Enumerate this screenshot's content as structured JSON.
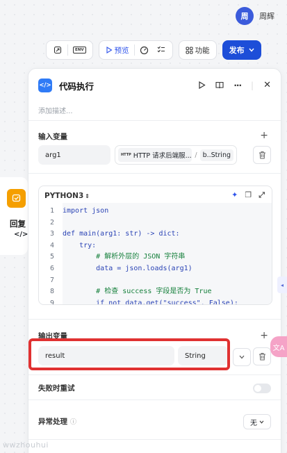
{
  "user": {
    "avatar_text": "周",
    "name": "周辉"
  },
  "toolbar": {
    "env_label": "ENV",
    "preview_label": "预览",
    "feature_label": "功能",
    "publish_label": "发布"
  },
  "node": {
    "label": "回复",
    "code_icon": "</>"
  },
  "panel": {
    "icon_text": "</>",
    "title": "代码执行",
    "description_placeholder": "添加描述...",
    "input_section": {
      "title": "输入变量",
      "var_name": "arg1",
      "ref_source": "HTTP 请求后端服...",
      "ref_sep": "/",
      "ref_path": "b..String"
    },
    "editor": {
      "language": "PYTHON3",
      "lines": [
        {
          "n": "1",
          "code": "import json"
        },
        {
          "n": "2",
          "code": ""
        },
        {
          "n": "3",
          "code": "def main(arg1: str) -> dict:"
        },
        {
          "n": "4",
          "code": "    try:"
        },
        {
          "n": "5",
          "code": "        # 解析外层的 JSON 字符串"
        },
        {
          "n": "6",
          "code": "        data = json.loads(arg1)"
        },
        {
          "n": "7",
          "code": ""
        },
        {
          "n": "8",
          "code": "        # 检查 success 字段是否为 True"
        },
        {
          "n": "9",
          "code": "        if not data.get(\"success\", False):"
        }
      ]
    },
    "output_section": {
      "title": "输出变量",
      "var_name": "result",
      "type": "String"
    },
    "retry_label": "失败时重试",
    "error_label": "异常处理",
    "error_value": "无"
  },
  "watermark": "wwzhouhui",
  "translate_icon": "文A"
}
